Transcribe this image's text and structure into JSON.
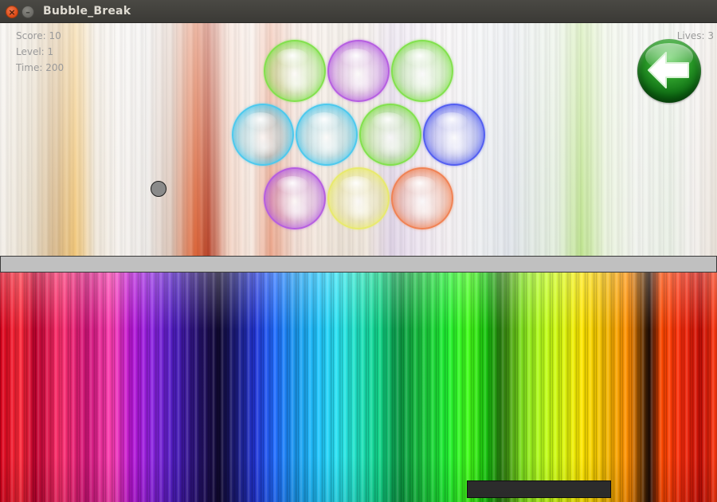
{
  "window": {
    "title": "Bubble_Break",
    "close_glyph": "×",
    "minimize_glyph": "–"
  },
  "hud": {
    "score": "Score: 10",
    "level": "Level: 1",
    "time": "Time: 200",
    "lives": "Lives: 3"
  },
  "back_button": {
    "icon": "arrow-left-icon",
    "color": "#1e8a1e"
  },
  "bubbles": [
    {
      "row": 1,
      "color": "green"
    },
    {
      "row": 1,
      "color": "purple"
    },
    {
      "row": 1,
      "color": "green"
    },
    {
      "row": 2,
      "color": "cyan"
    },
    {
      "row": 2,
      "color": "cyan"
    },
    {
      "row": 2,
      "color": "green"
    },
    {
      "row": 2,
      "color": "blue"
    },
    {
      "row": 3,
      "color": "purple"
    },
    {
      "row": 3,
      "color": "yellow"
    },
    {
      "row": 3,
      "color": "orange"
    }
  ],
  "colors": {
    "green": "#7fe04a",
    "purple": "#b45be0",
    "cyan": "#49c8ee",
    "blue": "#4f5bf0",
    "yellow": "#e8ea6a",
    "orange": "#f08050",
    "divider": "#c0c0c0",
    "paddle": "#2f2f2f",
    "ball": "#8a8a8a"
  }
}
